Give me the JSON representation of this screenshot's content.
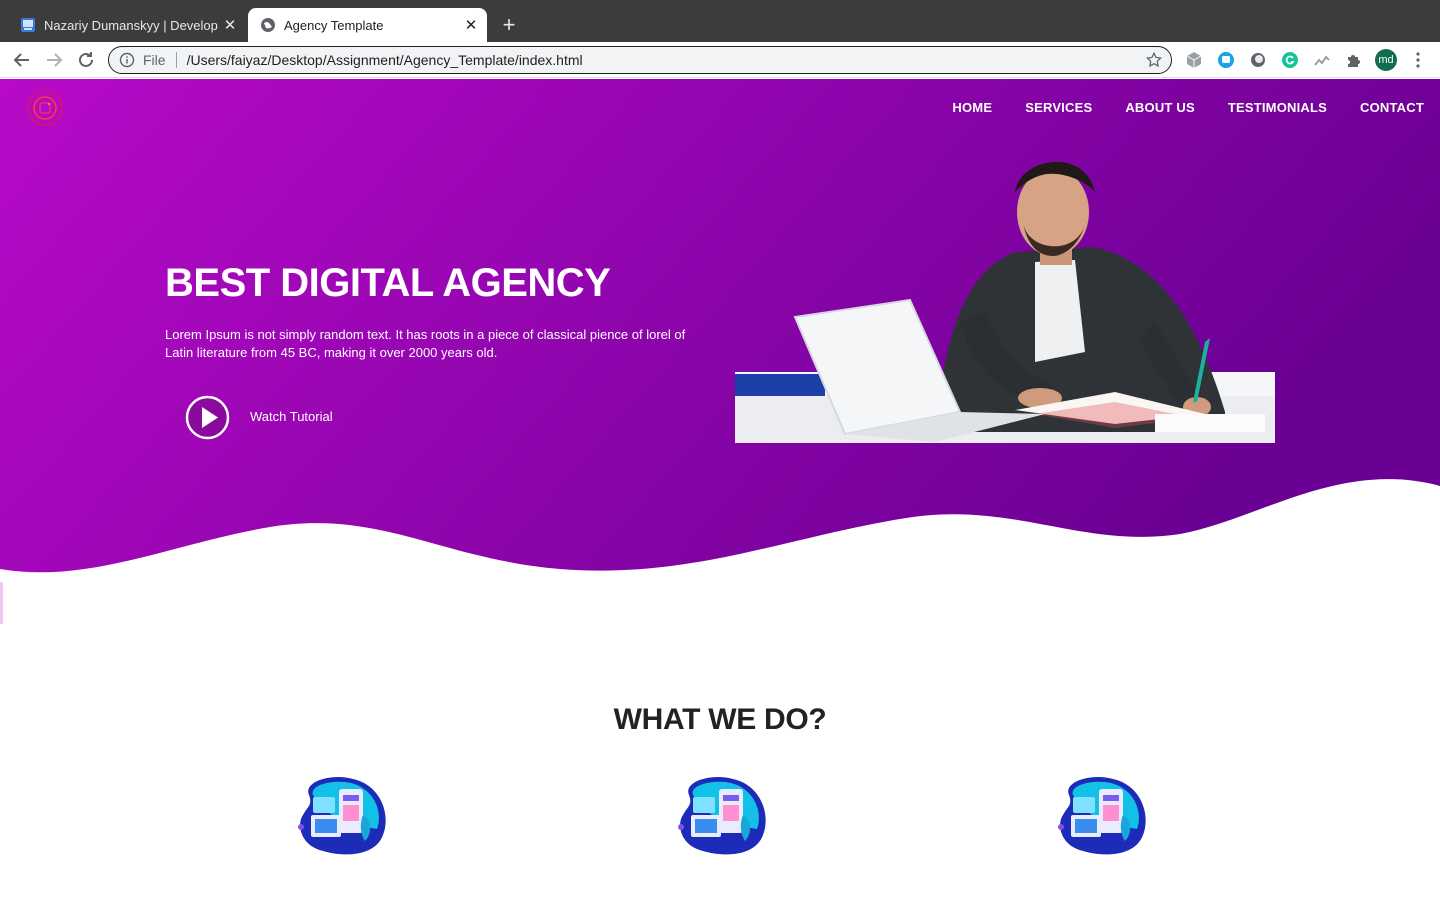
{
  "browser": {
    "tabs": [
      {
        "title": "Nazariy Dumanskyy | Developm",
        "active": false
      },
      {
        "title": "Agency Template",
        "active": true
      }
    ],
    "omnibox": {
      "scheme_label": "File",
      "url": "/Users/faiyaz/Desktop/Assignment/Agency_Template/index.html"
    },
    "profile_initials": "md"
  },
  "site": {
    "nav": [
      "HOME",
      "SERVICES",
      "ABOUT US",
      "TESTIMONIALS",
      "CONTACT"
    ],
    "hero": {
      "title": "BEST DIGITAL AGENCY",
      "description": "Lorem Ipsum is not simply random text. It has roots in a piece of classical pience of lorel of Latin literature from 45 BC, making it over 2000 years old.",
      "cta": "Watch Tutorial"
    },
    "section_title": "WHAT WE DO?",
    "colors": {
      "gradient_start": "#b50ac6",
      "gradient_end": "#6e0096",
      "text_dark": "#222222"
    }
  }
}
